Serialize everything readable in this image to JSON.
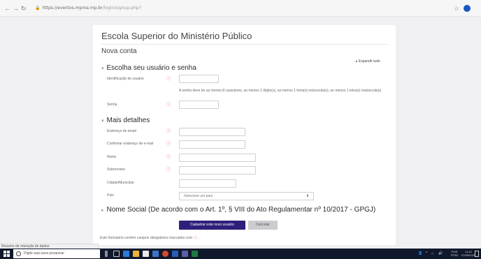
{
  "browser": {
    "url_host": "https://eventos.mpma.mp.br",
    "url_path": "/login/signup.php?",
    "back_icon": "arrow-left",
    "forward_icon": "arrow-right",
    "reload_icon": "reload",
    "bookmark_icon": "star-outline"
  },
  "page": {
    "site_title": "Escola Superior do Ministério Público",
    "heading": "Nova conta",
    "expand_all": "▸ Expandir tudo"
  },
  "section_account": {
    "title": "Escolha seu usuário e senha",
    "username_label": "Identificação de usuário",
    "password_hint": "A senha deve ter ao menos 8 caracteres, ao menos 1 dígito(s), ao menos 1 letra(s) minúscula(s), ao menos 1 letra(s) maiúscula(s)",
    "password_label": "Senha"
  },
  "section_details": {
    "title": "Mais detalhes",
    "email_label": "Endereço de email",
    "email_confirm_label": "Confirmar endereço de e-mail",
    "firstname_label": "Nome",
    "lastname_label": "Sobrenome",
    "city_label": "Cidade/Município",
    "country_label": "País",
    "country_selected": "Selecione um país"
  },
  "section_social": {
    "title": "Nome Social (De acordo com o Art. 1º, § VIII do Ato Regulamentar nº 10/2017 - GPGJ)"
  },
  "actions": {
    "submit_label": "Cadastrar este novo usuário",
    "cancel_label": "Cancelar"
  },
  "footer": {
    "required_note": "Este formulário contém campos obrigatórios marcados com",
    "required_note_end": "."
  },
  "statusbar": {
    "text": "Resumo de retenção de dados"
  },
  "taskbar": {
    "search_placeholder": "Digite aqui para pesquisar",
    "language": "POR",
    "layout": "PTB2",
    "time": "11:12",
    "date": "07/05/2021"
  },
  "colors": {
    "primary_button": "#2f1f7a",
    "required_marker": "#e26a6a",
    "taskbar_bg": "#10182b"
  }
}
